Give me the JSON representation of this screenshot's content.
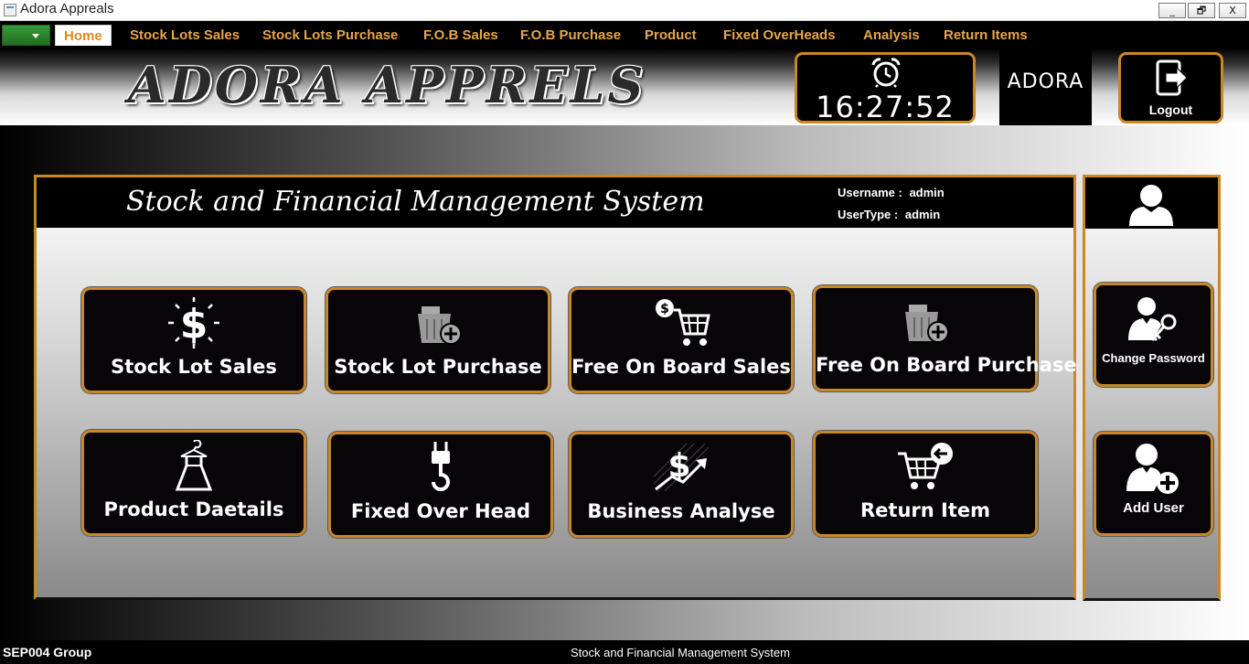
{
  "window": {
    "title": "Adora Appreals",
    "minimize": "_",
    "restore": "🗗",
    "close": "X"
  },
  "menu": {
    "items": [
      {
        "label": "Home",
        "active": true
      },
      {
        "label": "Stock Lots Sales"
      },
      {
        "label": "Stock Lots Purchase"
      },
      {
        "label": "F.O.B Sales"
      },
      {
        "label": "F.O.B Purchase"
      },
      {
        "label": "Product"
      },
      {
        "label": "Fixed OverHeads"
      },
      {
        "label": "Analysis"
      },
      {
        "label": "Return Items"
      }
    ]
  },
  "header": {
    "brand": "ADORA APPRELS",
    "clock_icon": "alarm-clock-icon",
    "time": "16:27:52",
    "logo": "ADORA",
    "logout_label": "Logout",
    "logout_icon": "logout-icon"
  },
  "panel": {
    "title": "Stock and Financial Management System",
    "username_label": "Username :",
    "username": "admin",
    "usertype_label": "UserType :",
    "usertype": "admin"
  },
  "tiles": [
    {
      "label": "Stock Lot Sales",
      "icon": "dollar-sign-icon"
    },
    {
      "label": "Stock Lot Purchase",
      "icon": "basket-add-icon"
    },
    {
      "label": "Free On Board Sales",
      "icon": "shopping-cart-dollar-icon"
    },
    {
      "label": "Free On Board Purchase",
      "icon": "basket-add-icon"
    },
    {
      "label": "Product Daetails",
      "icon": "dress-icon"
    },
    {
      "label": "Fixed Over Head",
      "icon": "crane-hook-icon"
    },
    {
      "label": "Business Analyse",
      "icon": "dollar-growth-icon"
    },
    {
      "label": "Return Item",
      "icon": "cart-return-icon"
    }
  ],
  "side": {
    "user_icon": "user-icon",
    "change_password": "Change Password",
    "change_password_icon": "user-key-icon",
    "add_user": "Add User",
    "add_user_icon": "user-add-icon"
  },
  "status": {
    "left": "SEP004 Group",
    "center": "Stock and Financial Management System"
  },
  "colors": {
    "accent": "#c8882a",
    "menu_text": "#e8a64a",
    "tile_bg": "#070507"
  }
}
